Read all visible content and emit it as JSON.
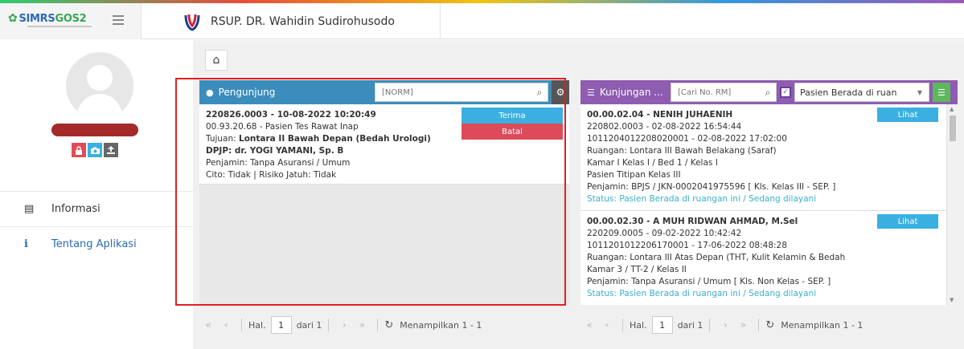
{
  "header": {
    "logo_text": "SIMRS",
    "logo_text2": "GOS2",
    "hospital_name": "RSUP. DR. Wahidin Sudirohusodo",
    "colors": {
      "logo_blue": "#2a6ab3",
      "logo_green": "#3aa655"
    }
  },
  "sidebar": {
    "menu": [
      {
        "label": "Informasi",
        "icon": "newspaper-icon"
      },
      {
        "label": "Tentang Aplikasi",
        "icon": "info-icon"
      }
    ],
    "avatar_actions": [
      "lock-icon",
      "camera-icon",
      "upload-icon"
    ]
  },
  "pengunjung": {
    "title": "Pengunjung",
    "search_placeholder": "[NORM]",
    "card": {
      "line1": "220826.0003 - 10-08-2022 10:20:49",
      "line2": "00.93.20.68 - Pasien Tes Rawat Inap",
      "tujuan_label": "Tujuan: ",
      "tujuan_value": "Lontara II Bawah Depan (Bedah Urologi)",
      "dpjp": "DPJP: dr. YOGI YAMANI, Sp. B",
      "penjamin": "Penjamin: Tanpa Asuransi / Umum",
      "cito": "Cito: Tidak | Risiko Jatuh: Tidak",
      "terima": "Terima",
      "batal": "Batal"
    },
    "pager": {
      "hal": "Hal.",
      "page": "1",
      "of": "dari 1",
      "info": "Menampilkan 1 - 1"
    }
  },
  "kunjungan": {
    "title": "Kunjungan ...",
    "search_placeholder": "[Cari No. RM]",
    "filter_value": "Pasien Berada di ruan",
    "cards": [
      {
        "name": "00.00.02.04 - NENIH JUHAENIH",
        "l2": "220802.0003 - 02-08-2022 16:54:44",
        "l3": "1011204012208020001 - 02-08-2022 17:02:00",
        "l4": "Ruangan: Lontara III Bawah Belakang (Saraf)",
        "l5": "Kamar I Kelas I / Bed 1 / Kelas I",
        "l6": "Pasien Titipan Kelas III",
        "l7": "Penjamin: BPJS / JKN-0002041975596 [ Kls. Kelas III - SEP. ]",
        "status": "Status: Pasien Berada di ruangan ini / Sedang dilayani",
        "button": "Lihat"
      },
      {
        "name": "00.00.02.30 - A MUH RIDWAN AHMAD, M.Sel",
        "l2": "220209.0005 - 09-02-2022 10:42:42",
        "l3": "1011201012206170001 - 17-06-2022 08:48:28",
        "l4": "Ruangan: Lontara III Atas Depan (THT, Kulit Kelamin & Bedah",
        "l5": "Kamar 3 / TT-2 / Kelas II",
        "l6": "Penjamin: Tanpa Asuransi / Umum [ Kls. Non Kelas - SEP. ]",
        "status": "Status: Pasien Berada di ruangan ini / Sedang dilayani",
        "button": "Lihat"
      }
    ],
    "pager": {
      "hal": "Hal.",
      "page": "1",
      "of": "dari 1",
      "info": "Menampilkan 1 - 1"
    }
  }
}
